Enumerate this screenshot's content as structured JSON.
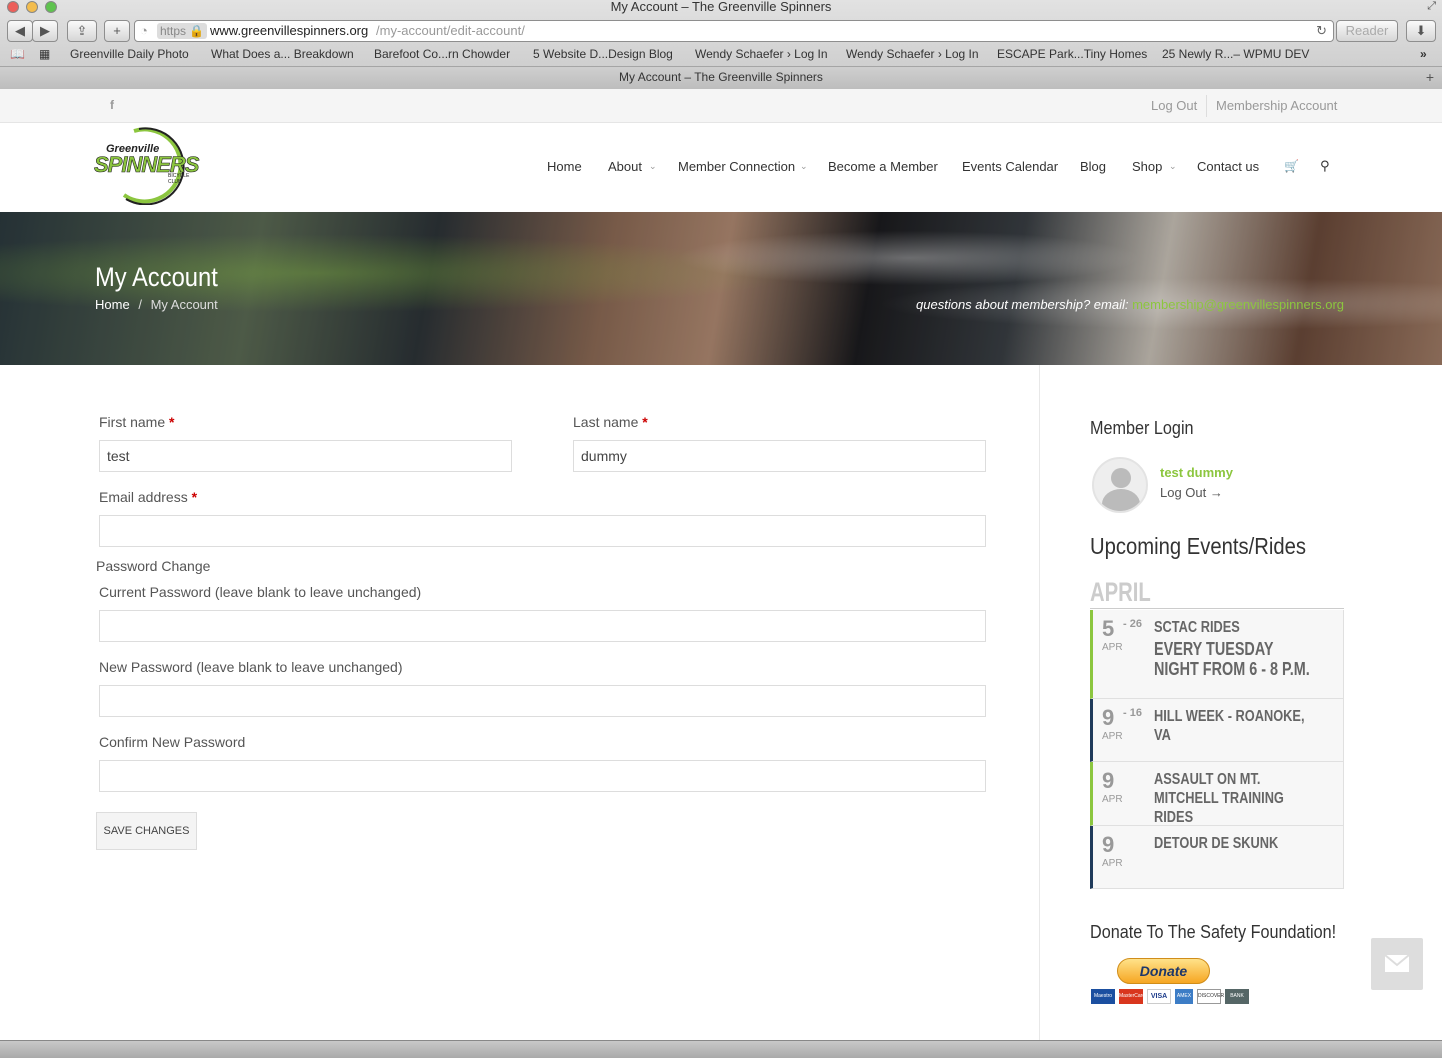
{
  "browser": {
    "window_title": "My Account – The Greenville Spinners",
    "url_https": "https",
    "url_domain": "www.greenvillespinners.org",
    "url_path": "/my-account/edit-account/",
    "reader_label": "Reader",
    "bookmarks": [
      "Greenville Daily Photo",
      "What Does a... Breakdown",
      "Barefoot Co...rn Chowder",
      "5 Website D...Design Blog",
      "Wendy Schaefer › Log In",
      "Wendy Schaefer › Log In",
      "ESCAPE Park...Tiny Homes",
      "25 Newly R...– WPMU DEV"
    ],
    "tab_title": "My Account – The Greenville Spinners"
  },
  "topbar": {
    "log_out": "Log Out",
    "membership_account": "Membership Account",
    "facebook_icon": "f"
  },
  "logo": {
    "top": "Greenville",
    "main": "SPINNERS",
    "sub": "BICYCLE CLUB"
  },
  "nav": {
    "items": [
      "Home",
      "About",
      "Member Connection",
      "Become a Member",
      "Events Calendar",
      "Blog",
      "Shop",
      "Contact us"
    ]
  },
  "hero": {
    "title": "My Account",
    "breadcrumb_home": "Home",
    "breadcrumb_sep": "/",
    "breadcrumb_current": "My Account",
    "question": "questions about membership? email: ",
    "email": "membership@greenvillespinners.org"
  },
  "form": {
    "first_name_label": "First name",
    "first_name_value": "test",
    "last_name_label": "Last name",
    "last_name_value": "dummy",
    "email_label": "Email address",
    "email_value": "",
    "required_mark": "*",
    "password_legend": "Password Change",
    "current_pw_label": "Current Password (leave blank to leave unchanged)",
    "new_pw_label": "New Password (leave blank to leave unchanged)",
    "confirm_pw_label": "Confirm New Password",
    "save_label": "SAVE CHANGES"
  },
  "sidebar": {
    "member_login_title": "Member Login",
    "user_name": "test dummy",
    "logout_link": "Log Out →",
    "events_title": "Upcoming Events/Rides",
    "month": "APRIL",
    "events": [
      {
        "day": "5",
        "end": "- 26",
        "mon": "APR",
        "title": "SCTAC RIDES",
        "sub": "EVERY TUESDAY NIGHT FROM 6 - 8 P.M."
      },
      {
        "day": "9",
        "end": "- 16",
        "mon": "APR",
        "title": "HILL WEEK - ROANOKE, VA",
        "sub": ""
      },
      {
        "day": "9",
        "end": "",
        "mon": "APR",
        "title": "ASSAULT ON MT. MITCHELL TRAINING RIDES",
        "sub": ""
      },
      {
        "day": "9",
        "end": "",
        "mon": "APR",
        "title": "DETOUR DE SKUNK",
        "sub": ""
      }
    ],
    "donate_title": "Donate To The Safety Foundation!",
    "donate_button": "Donate",
    "cards": [
      "Maestro",
      "MasterCard",
      "VISA",
      "AMEX",
      "DISCOVER",
      "BANK"
    ]
  },
  "colors": {
    "accent_green": "#8cc63f",
    "navy": "#1f3a5a"
  }
}
